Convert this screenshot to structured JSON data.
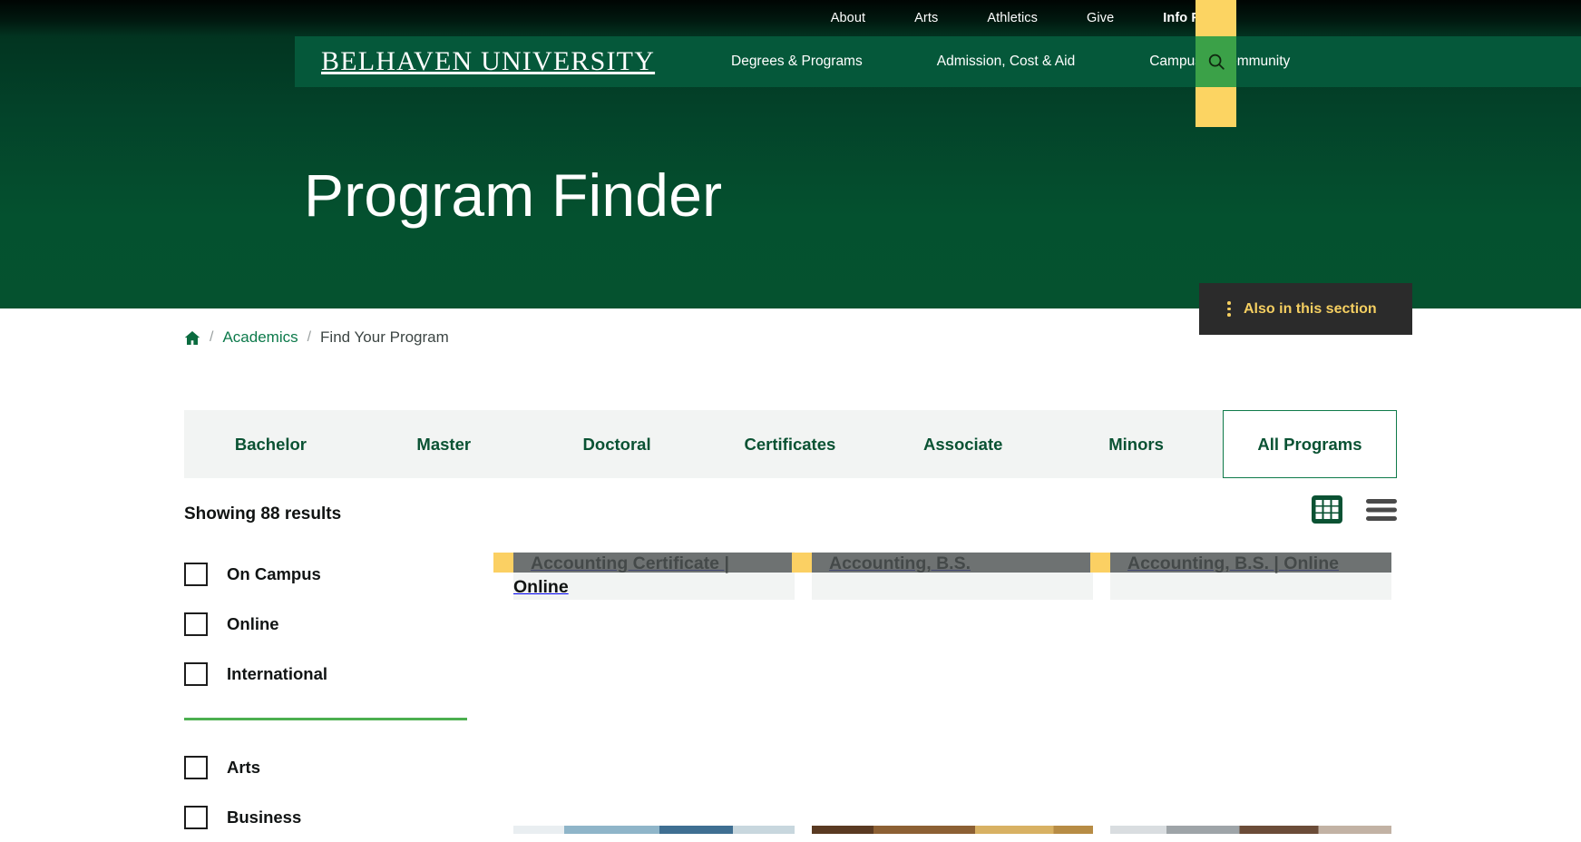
{
  "topbar": {
    "links": [
      "About",
      "Arts",
      "Athletics",
      "Give"
    ],
    "info_for": "Info For",
    "caret_icon": "chevron-up-icon"
  },
  "navbar": {
    "wordmark": "BELHAVEN UNIVERSITY",
    "links": [
      "Degrees & Programs",
      "Admission, Cost & Aid",
      "Campus & Community"
    ],
    "search_icon": "search-icon",
    "accent_color": "#fcd462",
    "search_bg": "#3ba148",
    "bar_color": "#05583a"
  },
  "hero": {
    "title": "Program Finder",
    "also_section": {
      "label": "Also in this section",
      "icon": "kebab-menu-icon",
      "bg": "#2b2b2b",
      "text_color": "#f5cf61"
    }
  },
  "breadcrumb": {
    "home_icon": "home-icon",
    "separator": "/",
    "items": [
      {
        "label": "Academics",
        "current": false
      },
      {
        "label": "Find Your Program",
        "current": true
      }
    ]
  },
  "tabs": {
    "items": [
      {
        "label": "Bachelor",
        "active": false
      },
      {
        "label": "Master",
        "active": false
      },
      {
        "label": "Doctoral",
        "active": false
      },
      {
        "label": "Certificates",
        "active": false
      },
      {
        "label": "Associate",
        "active": false
      },
      {
        "label": "Minors",
        "active": false
      },
      {
        "label": "All Programs",
        "active": true
      }
    ]
  },
  "results": {
    "count_label": "Showing 88 results",
    "count": 88,
    "grid_view_icon": "grid-view-icon",
    "list_view_icon": "list-view-icon",
    "active_view": "grid"
  },
  "filters": {
    "modality": [
      {
        "label": "On Campus",
        "checked": false
      },
      {
        "label": "Online",
        "checked": false
      },
      {
        "label": "International",
        "checked": false
      }
    ],
    "divider_color": "#4caf50",
    "categories": [
      {
        "label": "Arts",
        "checked": false
      },
      {
        "label": "Business",
        "checked": false
      }
    ]
  },
  "cards": [
    {
      "title": "Accounting Certificate | Online",
      "image": "accounting-ledger-magnifier-coins-photo"
    },
    {
      "title": "Accounting, B.S.",
      "image": "charts-calculator-pen-photo"
    },
    {
      "title": "Accounting, B.S. | Online",
      "image": "office-laptop-hands-photo"
    }
  ]
}
